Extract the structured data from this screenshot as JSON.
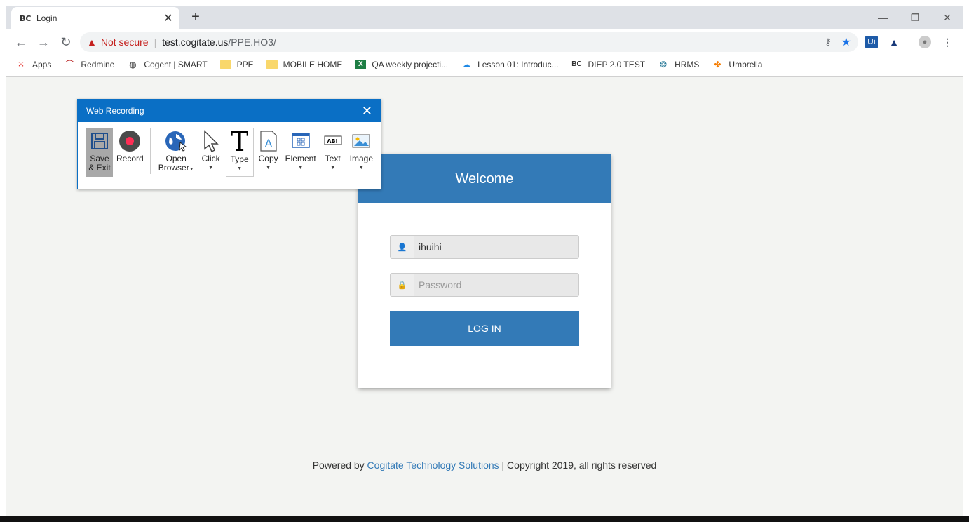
{
  "browser": {
    "tab_title": "Login",
    "tab_favicon": "BC",
    "new_tab_label": "+",
    "url_warning": "Not secure",
    "url_host": "test.cogitate.us",
    "url_path": "/PPE.HO3/",
    "bookmarks": [
      {
        "label": "Apps",
        "icon": "apps-grid-icon"
      },
      {
        "label": "Redmine",
        "icon": "redmine-icon"
      },
      {
        "label": "Cogent | SMART",
        "icon": "globe-icon"
      },
      {
        "label": "PPE",
        "icon": "folder-icon"
      },
      {
        "label": "MOBILE HOME",
        "icon": "folder-icon"
      },
      {
        "label": "QA weekly projecti...",
        "icon": "excel-icon"
      },
      {
        "label": "Lesson 01: Introduc...",
        "icon": "cloud-icon"
      },
      {
        "label": "DIEP 2.0 TEST",
        "icon": "bc-icon"
      },
      {
        "label": "HRMS",
        "icon": "hrms-icon"
      },
      {
        "label": "Umbrella",
        "icon": "umbrella-icon"
      }
    ],
    "extensions": {
      "uipath": "Ui"
    }
  },
  "recorder": {
    "title": "Web Recording",
    "tools": [
      {
        "label": "Save\n& Exit",
        "line1": "Save",
        "line2": "& Exit",
        "icon": "floppy-disk-icon"
      },
      {
        "label": "Record",
        "icon": "record-icon"
      },
      {
        "label": "Open Browser",
        "line1": "Open",
        "line2": "Browser",
        "icon": "globe-cursor-icon"
      },
      {
        "label": "Click",
        "icon": "cursor-icon"
      },
      {
        "label": "Type",
        "icon": "type-t-icon"
      },
      {
        "label": "Copy",
        "icon": "copy-a-icon"
      },
      {
        "label": "Element",
        "icon": "element-window-icon"
      },
      {
        "label": "Text",
        "icon": "text-abi-icon"
      },
      {
        "label": "Image",
        "icon": "image-icon"
      }
    ]
  },
  "login": {
    "header": "Welcome",
    "username_value": "ihuihi",
    "password_placeholder": "Password",
    "button": "LOG IN"
  },
  "footer": {
    "prefix": "Powered by ",
    "company": "Cogitate Technology Solutions",
    "suffix": " | Copyright 2019, all rights reserved"
  },
  "colors": {
    "brand_blue": "#337ab7",
    "recorder_blue": "#0a6fc5",
    "warning_red": "#c5221f"
  }
}
